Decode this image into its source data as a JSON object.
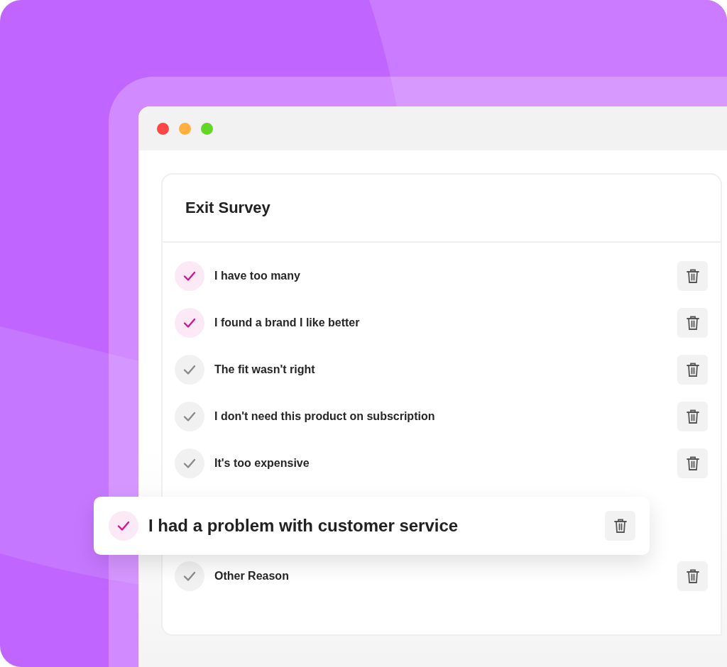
{
  "window": {
    "controls": [
      {
        "color": "#ff4646"
      },
      {
        "color": "#ffb040"
      },
      {
        "color": "#62d824"
      }
    ]
  },
  "survey": {
    "title": "Exit Survey",
    "reasons": [
      {
        "text": "I have too many",
        "checked": true
      },
      {
        "text": "I found a brand I like better",
        "checked": true
      },
      {
        "text": "The fit wasn't right",
        "checked": false
      },
      {
        "text": "I don't need this product on subscription",
        "checked": false
      },
      {
        "text": "It's too expensive",
        "checked": false
      }
    ],
    "floating_reason": {
      "text": "I had a problem with customer service",
      "checked": true
    },
    "more_reasons": [
      {
        "text": "Other Reason",
        "checked": false
      }
    ]
  }
}
